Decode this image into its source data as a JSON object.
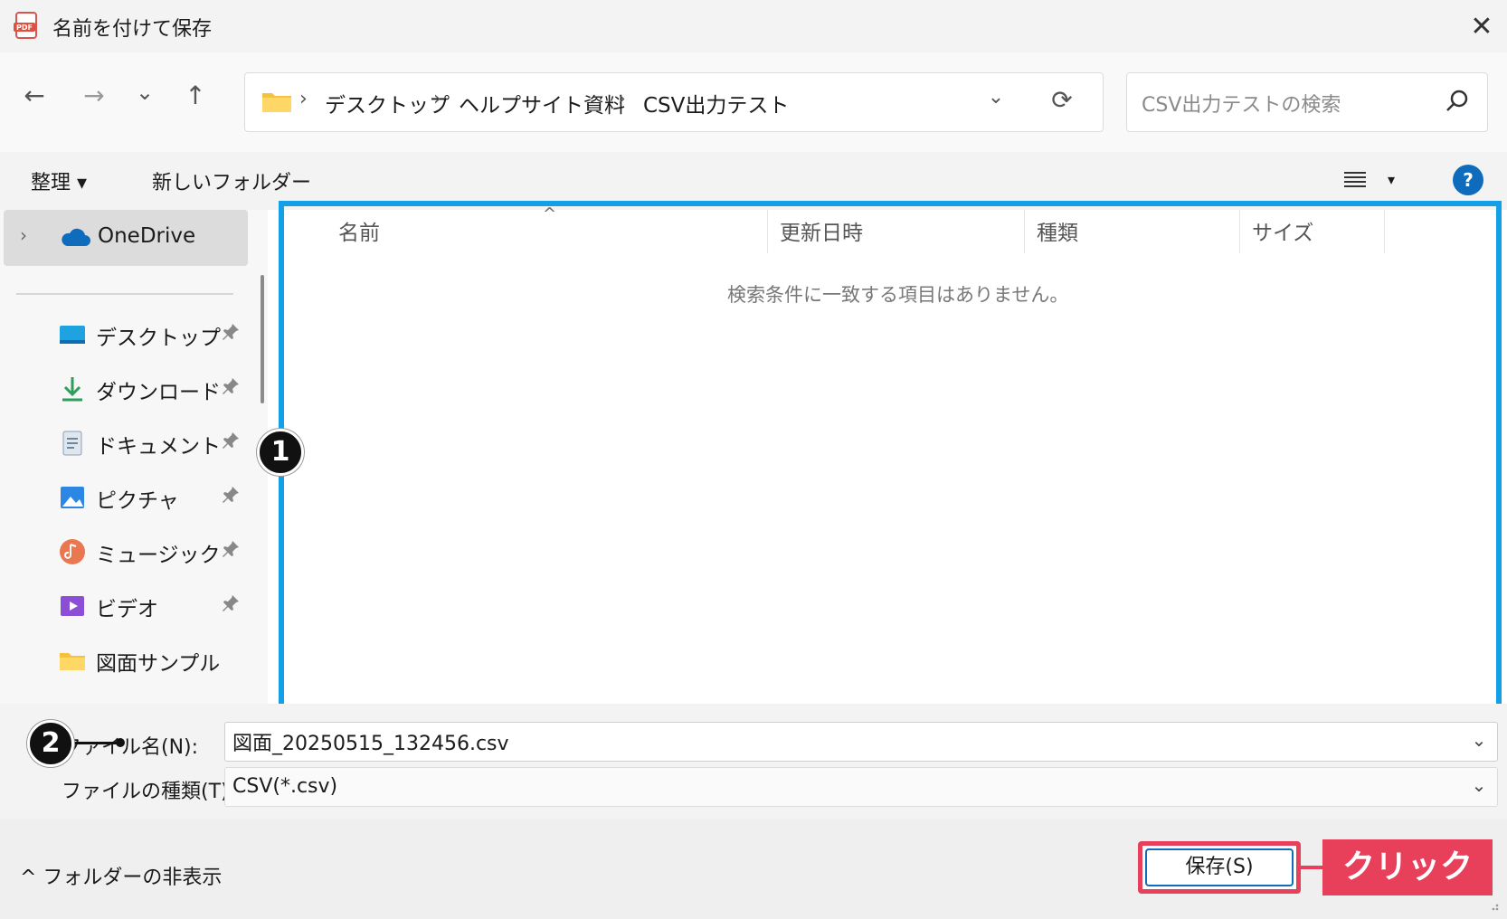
{
  "window": {
    "title": "名前を付けて保存",
    "app_icon": "pdf-app-icon",
    "close_glyph": "✕"
  },
  "nav": {
    "back_glyph": "←",
    "forward_glyph": "→",
    "recent_glyph": "⌄",
    "up_glyph": "↑",
    "breadcrumbs": [
      "デスクトップ",
      "ヘルプサイト資料",
      "CSV出力テスト"
    ],
    "separator": "›",
    "search_placeholder": "CSV出力テストの検索"
  },
  "commands": {
    "organize": "整理 ▾",
    "new_folder": "新しいフォルダー",
    "view_dropdown": "▾",
    "help": "?"
  },
  "sidebar": {
    "onedrive": "OneDrive",
    "quick_access": [
      {
        "label": "デスクトップ",
        "icon": "desktop-icon"
      },
      {
        "label": "ダウンロード",
        "icon": "download-icon"
      },
      {
        "label": "ドキュメント",
        "icon": "document-icon"
      },
      {
        "label": "ピクチャ",
        "icon": "pictures-icon"
      },
      {
        "label": "ミュージック",
        "icon": "music-icon"
      },
      {
        "label": "ビデオ",
        "icon": "video-icon"
      },
      {
        "label": "図面サンプル",
        "icon": "folder-icon"
      }
    ]
  },
  "file_list": {
    "columns": [
      "名前",
      "更新日時",
      "種類",
      "サイズ"
    ],
    "empty_message": "検索条件に一致する項目はありません。",
    "sort_indicator": "^"
  },
  "form": {
    "filename_label": "ファイル名(N):",
    "filename_value": "図面_20250515_132456.csv",
    "filetype_label": "ファイルの種類(T):",
    "filetype_value": "CSV(*.csv)",
    "dropdown_glyph": "⌄"
  },
  "footer": {
    "hide_folders": "^ フォルダーの非表示",
    "save_button": "保存(S)"
  },
  "annotations": {
    "badge1": "1",
    "badge2": "2",
    "click_label": "クリック",
    "highlight_color": "#14a0e6",
    "callout_color": "#e8405a"
  }
}
